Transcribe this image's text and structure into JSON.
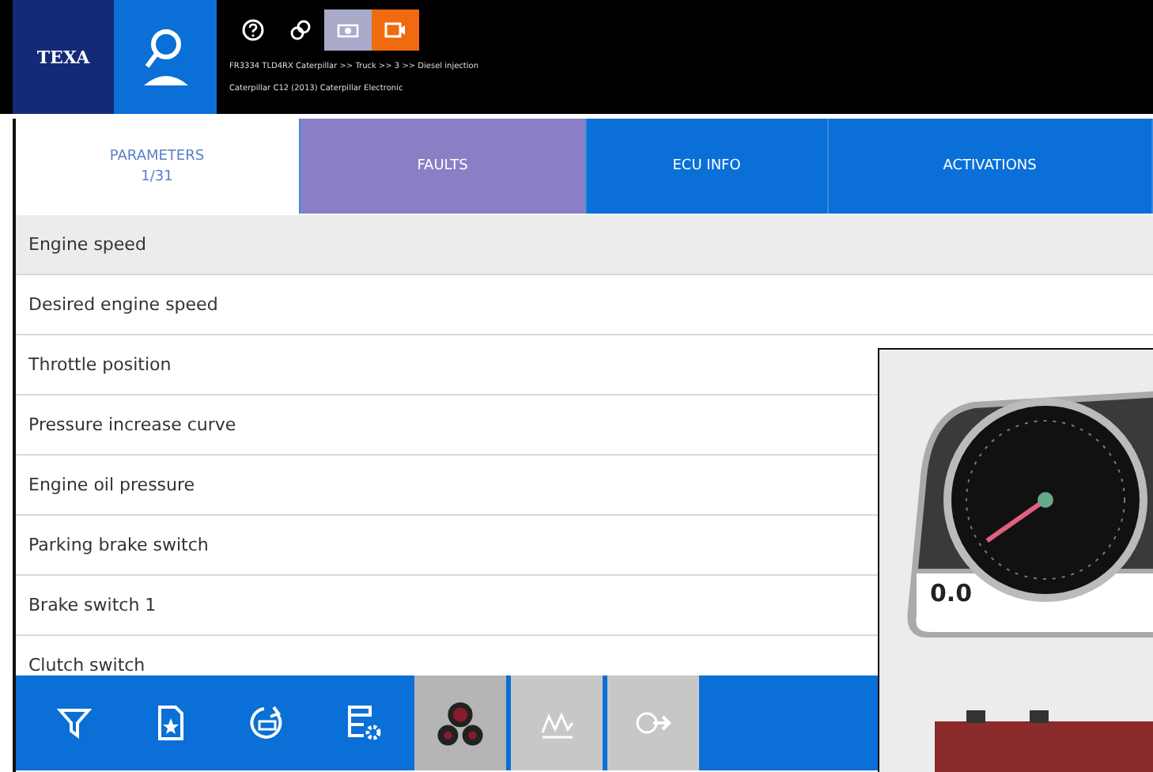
{
  "header": {
    "logo": "TEXA",
    "vehicle_lines": [
      "FR3334 TLD4RX Caterpillar >> Truck >> 3 >> Diesel injection",
      "Caterpillar C12 (2013) Caterpillar Electronic"
    ],
    "status_buttons": [
      {
        "kind": "help"
      },
      {
        "kind": "link"
      },
      {
        "kind": "camera",
        "color": "#a9a9c9"
      },
      {
        "kind": "record",
        "color": "#f06a10"
      }
    ]
  },
  "tabs": [
    {
      "label": "PARAMETERS",
      "sub": "1/31",
      "selected": true,
      "color": "#ffffff"
    },
    {
      "label": "FAULTS",
      "selected": false,
      "color": "#8a7fc4"
    },
    {
      "label": "ECU INFO",
      "selected": false,
      "color": "#0a6fd6"
    },
    {
      "label": "ACTIVATIONS",
      "selected": false,
      "color": "#0a6fd6"
    }
  ],
  "parameters": [
    {
      "name": "Engine speed",
      "selected": true
    },
    {
      "name": "Desired engine speed",
      "selected": false
    },
    {
      "name": "Throttle position",
      "selected": false
    },
    {
      "name": "Pressure increase curve",
      "selected": false
    },
    {
      "name": "Engine oil pressure",
      "selected": false
    },
    {
      "name": "Parking brake switch",
      "selected": false
    },
    {
      "name": "Brake switch 1",
      "selected": false
    },
    {
      "name": "Clutch switch",
      "selected": false
    }
  ],
  "gauge_panel": {
    "reading": "0.0"
  },
  "toolbar": [
    {
      "kind": "filter",
      "view": false,
      "selected": false
    },
    {
      "kind": "favorite",
      "view": false,
      "selected": false
    },
    {
      "kind": "reset",
      "view": false,
      "selected": false
    },
    {
      "kind": "settings",
      "view": false,
      "selected": false
    },
    {
      "kind": "gauges",
      "view": true,
      "selected": true
    },
    {
      "kind": "graph",
      "view": true,
      "selected": false
    },
    {
      "kind": "export",
      "view": true,
      "selected": false
    }
  ]
}
